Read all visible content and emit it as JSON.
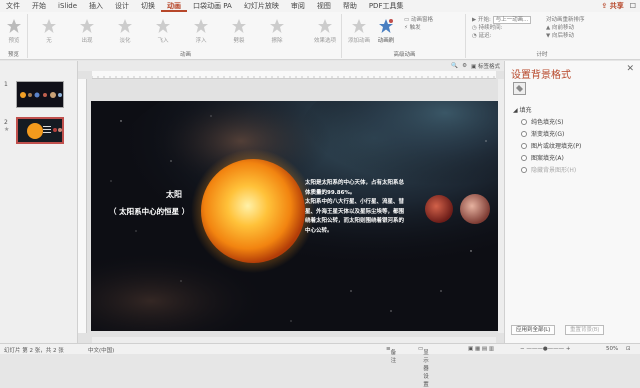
{
  "tabs": [
    "文件",
    "开始",
    "iSlide",
    "插入",
    "设计",
    "切换",
    "动画",
    "口袋动画 PA",
    "幻灯片放映",
    "审阅",
    "视图",
    "帮助",
    "PDF工具集"
  ],
  "active_tab": "动画",
  "share": "共享",
  "ribbon": {
    "preview": "预览",
    "preview_group": "预览",
    "animations": [
      "无",
      "出现",
      "淡化",
      "飞入",
      "浮入",
      "劈裂",
      "擦除"
    ],
    "effect_options": "效果选项",
    "anim_group": "动画",
    "add_anim": "添加动画",
    "anim_pane": "动画窗格",
    "anim_painter": "动画刷",
    "advanced_group": "高级动画",
    "trigger": "触发",
    "start": "开始:",
    "start_val": "与上一动画...",
    "duration": "持续时间:",
    "delay": "延迟:",
    "reorder": "对动画重新排序",
    "move_earlier": "向前移动",
    "move_later": "向后移动",
    "timing_group": "计时"
  },
  "toolbar": {
    "label_format": "标签格式"
  },
  "slide": {
    "title": "太阳",
    "subtitle": "（ 太阳系中心的恒星 ）",
    "body": "太阳是太阳系的中心天体，占有太阳系总体质量的99.86%。\n太阳系中的八大行星、小行星、流星、彗星、外海王星天体以及星际尘埃等，都围绕着太阳公转，而太阳则围绕着银河系的中心公转。"
  },
  "right_panel": {
    "title": "设置背景格式",
    "section": "填充",
    "options": [
      "纯色填充(S)",
      "渐变填充(G)",
      "图片或纹理填充(P)",
      "图案填充(A)",
      "隐藏背景图形(H)"
    ],
    "apply_all": "应用到全部(L)",
    "reset": "重置背景(B)"
  },
  "status": {
    "slide_info": "幻灯片 第 2 张，共 2 张",
    "language": "中文(中国)",
    "notes": "备注",
    "display": "显示器设置",
    "zoom": "50%"
  },
  "colors": {
    "accent": "#b7472a"
  }
}
